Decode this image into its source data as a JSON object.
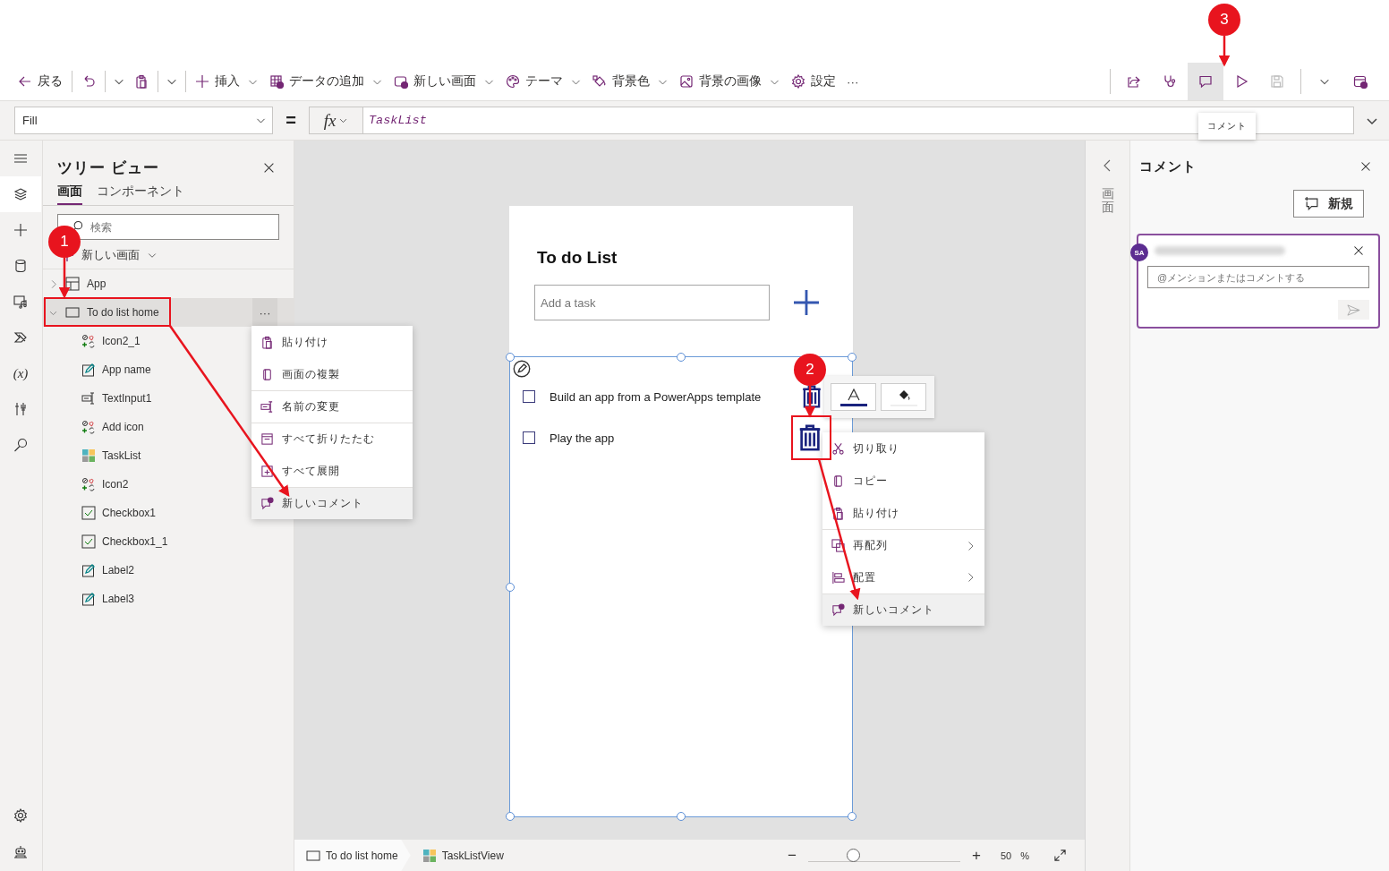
{
  "toolbar": {
    "left": [
      {
        "kind": "back",
        "label": "戻る",
        "dropdown": false
      },
      {
        "kind": "separator"
      },
      {
        "kind": "undo",
        "dropdown": false
      },
      {
        "kind": "separator"
      },
      {
        "kind": "caret"
      },
      {
        "kind": "paste",
        "dropdown": false
      },
      {
        "kind": "separator"
      },
      {
        "kind": "caret"
      },
      {
        "kind": "separator"
      },
      {
        "kind": "insert",
        "label": "挿入",
        "dropdown": true
      },
      {
        "kind": "data",
        "label": "データの追加",
        "dropdown": true
      },
      {
        "kind": "screen",
        "label": "新しい画面",
        "dropdown": true
      },
      {
        "kind": "theme",
        "label": "テーマ",
        "dropdown": true
      },
      {
        "kind": "fill",
        "label": "背景色",
        "dropdown": true
      },
      {
        "kind": "image",
        "label": "背景の画像",
        "dropdown": true
      },
      {
        "kind": "settings",
        "label": "設定",
        "dropdown": false
      },
      {
        "kind": "more",
        "label": "···",
        "dropdown": false
      }
    ],
    "right": [
      {
        "kind": "separator"
      },
      {
        "kind": "share",
        "selected": false,
        "disabled": false
      },
      {
        "kind": "health",
        "selected": false,
        "disabled": false
      },
      {
        "kind": "comment",
        "selected": true,
        "disabled": false
      },
      {
        "kind": "play",
        "selected": false,
        "disabled": false
      },
      {
        "kind": "save",
        "selected": false,
        "disabled": true
      },
      {
        "kind": "separator"
      },
      {
        "kind": "caret",
        "selected": false,
        "disabled": false
      },
      {
        "kind": "publish",
        "selected": false,
        "disabled": false
      }
    ],
    "tooltip": "コメント"
  },
  "formula": {
    "property": "Fill",
    "equals": "=",
    "fx": "fx",
    "value": "TaskList"
  },
  "left_rail": {
    "items": [
      {
        "kind": "menu",
        "selected": false
      },
      {
        "kind": "layers",
        "selected": true
      },
      {
        "kind": "insert",
        "selected": false
      },
      {
        "kind": "data",
        "selected": false
      },
      {
        "kind": "media",
        "selected": false
      },
      {
        "kind": "automate",
        "selected": false
      },
      {
        "kind": "variables",
        "glyph": "(x)",
        "selected": false
      },
      {
        "kind": "tools",
        "selected": false
      },
      {
        "kind": "search",
        "selected": false
      }
    ],
    "bottom": [
      {
        "kind": "settings",
        "selected": false
      },
      {
        "kind": "copilot",
        "selected": false
      }
    ]
  },
  "tree_view": {
    "title": "ツリー ビュー",
    "tabs": [
      {
        "label": "画面",
        "selected": true
      },
      {
        "label": "コンポーネント",
        "selected": false
      }
    ],
    "search": {
      "placeholder": "検索"
    },
    "new_screen": "新しい画面",
    "more_button": "···",
    "items": [
      {
        "kind": "app",
        "label": "App",
        "expanded": false,
        "selected": false
      },
      {
        "kind": "screen",
        "label": "To do list home",
        "expanded": true,
        "selected": true,
        "children": [
          {
            "kind": "icon",
            "label": "Icon2_1",
            "selected": false
          },
          {
            "kind": "label",
            "label": "App name",
            "selected": false
          },
          {
            "kind": "textinput",
            "label": "TextInput1",
            "selected": false
          },
          {
            "kind": "icon",
            "label": "Add icon",
            "selected": false
          },
          {
            "kind": "gallery",
            "label": "TaskList",
            "selected": false
          },
          {
            "kind": "icon",
            "label": "Icon2",
            "selected": false
          },
          {
            "kind": "checkbox",
            "label": "Checkbox1",
            "selected": false
          },
          {
            "kind": "checkbox",
            "label": "Checkbox1_1",
            "selected": false
          },
          {
            "kind": "label",
            "label": "Label2",
            "selected": false
          },
          {
            "kind": "label",
            "label": "Label3",
            "selected": false
          }
        ]
      }
    ]
  },
  "screen_menu": [
    {
      "kind": "paste",
      "label": "貼り付け",
      "divider_before": false,
      "submenu": false,
      "highlighted": false
    },
    {
      "kind": "duplicate",
      "label": "画面の複製",
      "divider_before": false,
      "submenu": false,
      "highlighted": false
    },
    {
      "kind": "rename",
      "label": "名前の変更",
      "divider_before": true,
      "submenu": false,
      "highlighted": false
    },
    {
      "kind": "collapse",
      "label": "すべて折りたたむ",
      "divider_before": true,
      "submenu": false,
      "highlighted": false
    },
    {
      "kind": "expand",
      "label": "すべて展開",
      "divider_before": false,
      "submenu": false,
      "highlighted": false
    },
    {
      "kind": "comment",
      "label": "新しいコメント",
      "divider_before": true,
      "submenu": false,
      "highlighted": true
    }
  ],
  "app_screen": {
    "title": "To do List",
    "input": {
      "placeholder": "Add a task"
    },
    "rows": [
      {
        "label": "Build an app from a PowerApps template",
        "checked": false
      },
      {
        "label": "Play the app",
        "checked": false
      }
    ]
  },
  "control_menu": [
    {
      "kind": "cut",
      "label": "切り取り",
      "divider_before": false,
      "submenu": false,
      "highlighted": false
    },
    {
      "kind": "copy",
      "label": "コピー",
      "divider_before": false,
      "submenu": false,
      "highlighted": false
    },
    {
      "kind": "paste",
      "label": "貼り付け",
      "divider_before": false,
      "submenu": false,
      "highlighted": false
    },
    {
      "kind": "reorder",
      "label": "再配列",
      "divider_before": true,
      "submenu": true,
      "highlighted": false
    },
    {
      "kind": "align",
      "label": "配置",
      "divider_before": false,
      "submenu": true,
      "highlighted": false
    },
    {
      "kind": "comment",
      "label": "新しいコメント",
      "divider_before": true,
      "submenu": false,
      "highlighted": true
    }
  ],
  "status_bar": {
    "crumbs": [
      {
        "kind": "screen",
        "label": "To do list home"
      },
      {
        "kind": "gallery",
        "label": "TaskListView"
      }
    ],
    "zoom": {
      "minus": "−",
      "level": 0.3,
      "plus": "+",
      "value": "50",
      "unit": "%"
    }
  },
  "side_rail": {
    "label": "画面"
  },
  "comments": {
    "title": "コメント",
    "new_button": "新規",
    "card": {
      "avatar": "SA",
      "placeholder": "@メンションまたはコメントする"
    }
  },
  "annotations": [
    {
      "label": "1"
    },
    {
      "label": "2"
    },
    {
      "label": "3"
    }
  ]
}
